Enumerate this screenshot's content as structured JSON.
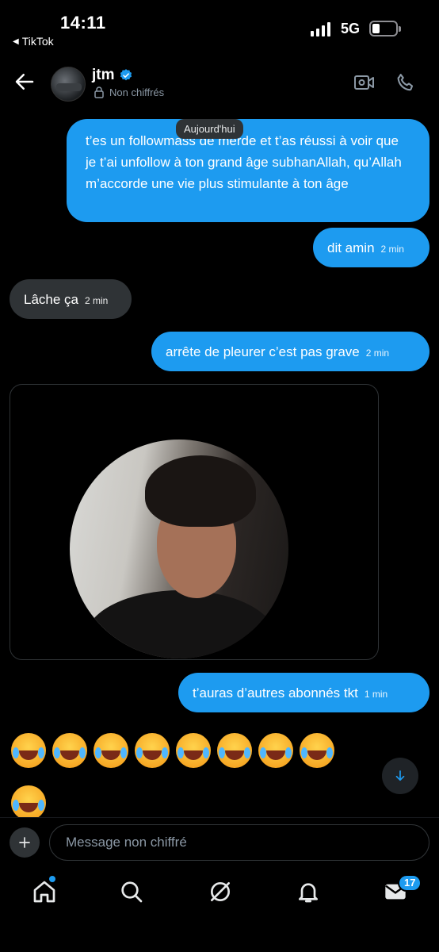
{
  "status_bar": {
    "time": "14:11",
    "back_app": "TikTok",
    "network": "5G"
  },
  "header": {
    "contact_name": "jtm",
    "encryption": "Non chiffrés"
  },
  "date_chip": "Aujourd'hui",
  "messages": [
    {
      "direction": "out",
      "text": "t’es un followmass de merde et t’as réussi à voir que je t’ai unfollow à ton grand âge subhanAllah, qu’Allah m’accorde une vie plus stimulante à ton âge",
      "time": ""
    },
    {
      "direction": "out",
      "text": "dit amin",
      "time": "2 min"
    },
    {
      "direction": "in",
      "text": "Lâche ça",
      "time": "2 min"
    },
    {
      "direction": "out",
      "text": "arrête de pleurer c’est pas grave",
      "time": "2 min"
    },
    {
      "direction": "out",
      "text": "t’auras d’autres abonnés tkt",
      "time": "1 min"
    }
  ],
  "emoji_reaction": "face-with-tears-of-joy",
  "emoji_row_count": 8,
  "composer": {
    "placeholder": "Message non chiffré"
  },
  "nav": {
    "messages_badge": "17"
  },
  "colors": {
    "accent": "#1d9bf0",
    "incoming_bubble": "#2f3336",
    "background": "#000000"
  }
}
